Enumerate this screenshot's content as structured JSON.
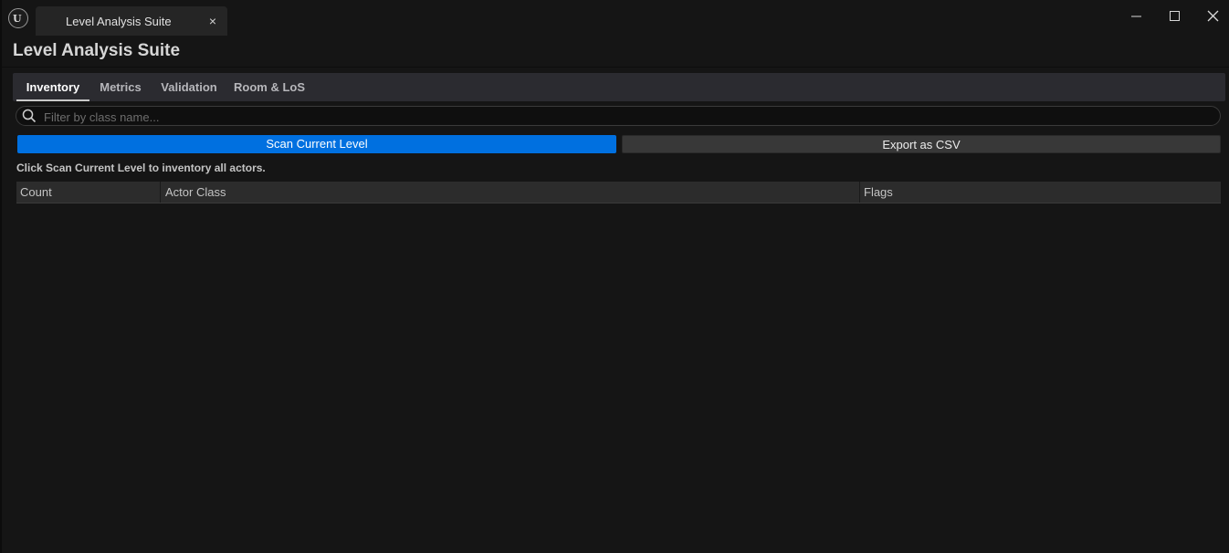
{
  "window": {
    "tab_title": "Level Analysis Suite",
    "tab_close": "×",
    "logo_icon": "unreal-logo-icon",
    "controls": [
      "minimize-icon",
      "maximize-icon",
      "close-icon"
    ]
  },
  "panel": {
    "title": "Level Analysis Suite"
  },
  "tabs": [
    {
      "label": "Inventory",
      "active": true
    },
    {
      "label": "Metrics",
      "active": false
    },
    {
      "label": "Validation",
      "active": false
    },
    {
      "label": "Room & LoS",
      "active": false
    }
  ],
  "search": {
    "placeholder": "Filter by class name...",
    "value": "",
    "icon": "search-icon"
  },
  "actions": {
    "scan_label": "Scan Current Level",
    "export_label": "Export as CSV"
  },
  "hint": "Click Scan Current Level to inventory all actors.",
  "table": {
    "columns": [
      "Count",
      "Actor Class",
      "Flags"
    ],
    "rows": []
  },
  "colors": {
    "accent": "#0070e0",
    "background": "#151515",
    "tabbar": "#2b2b30"
  }
}
